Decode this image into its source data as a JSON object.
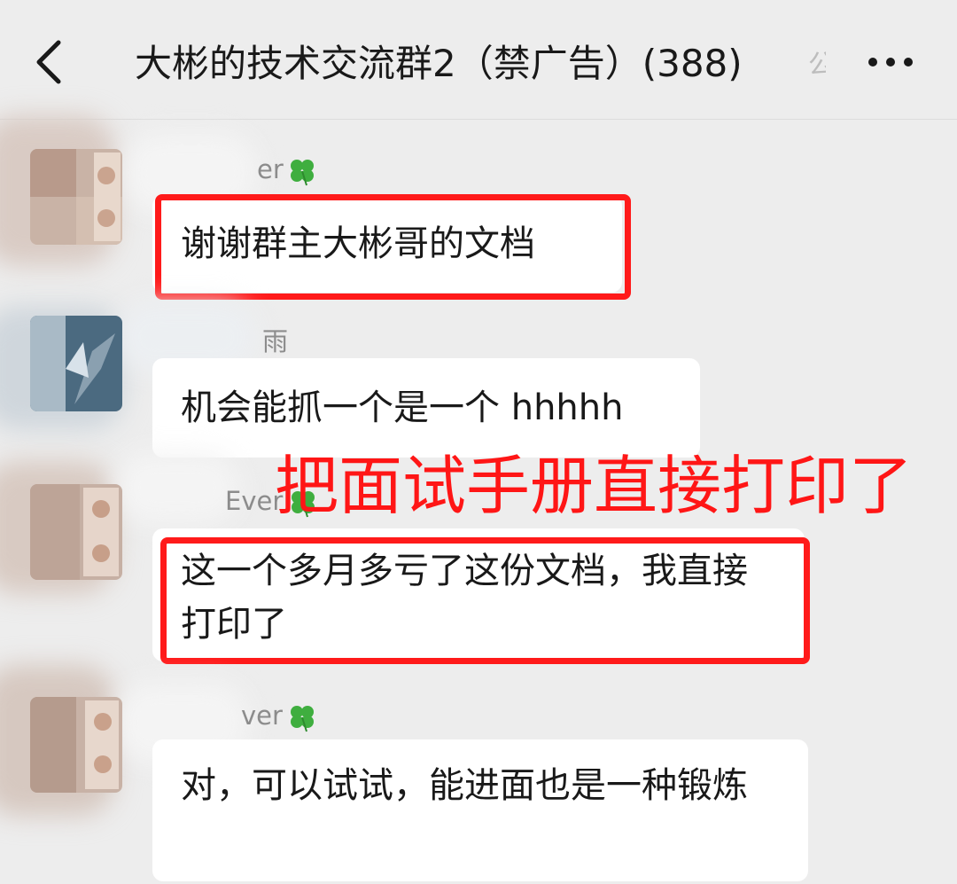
{
  "header": {
    "back_icon": "chevron-left-icon",
    "title": "大彬的技术交流群2（禁广告）(388)",
    "title_overflow_char": "公",
    "more_icon": "ellipsis-horizontal-icon"
  },
  "messages": [
    {
      "sender_visible": "er",
      "text": "谢谢群主大彬哥的文档",
      "highlighted": true
    },
    {
      "sender_visible": "雨",
      "text": "机会能抓一个是一个 hhhhh",
      "highlighted": false
    },
    {
      "sender_visible": "Ever",
      "text": "这一个多月多亏了这份文档，我直接打印了",
      "highlighted": true
    },
    {
      "sender_visible": "ver",
      "text": "对，可以试试，能进面也是一种锻炼",
      "highlighted": false
    }
  ],
  "annotation": {
    "text": "把面试手册直接打印了",
    "color": "#ff1616"
  },
  "colors": {
    "background": "#ededed",
    "bubble": "#ffffff",
    "highlight_red": "#ff1a1a",
    "nickname": "#8c8c8c"
  }
}
